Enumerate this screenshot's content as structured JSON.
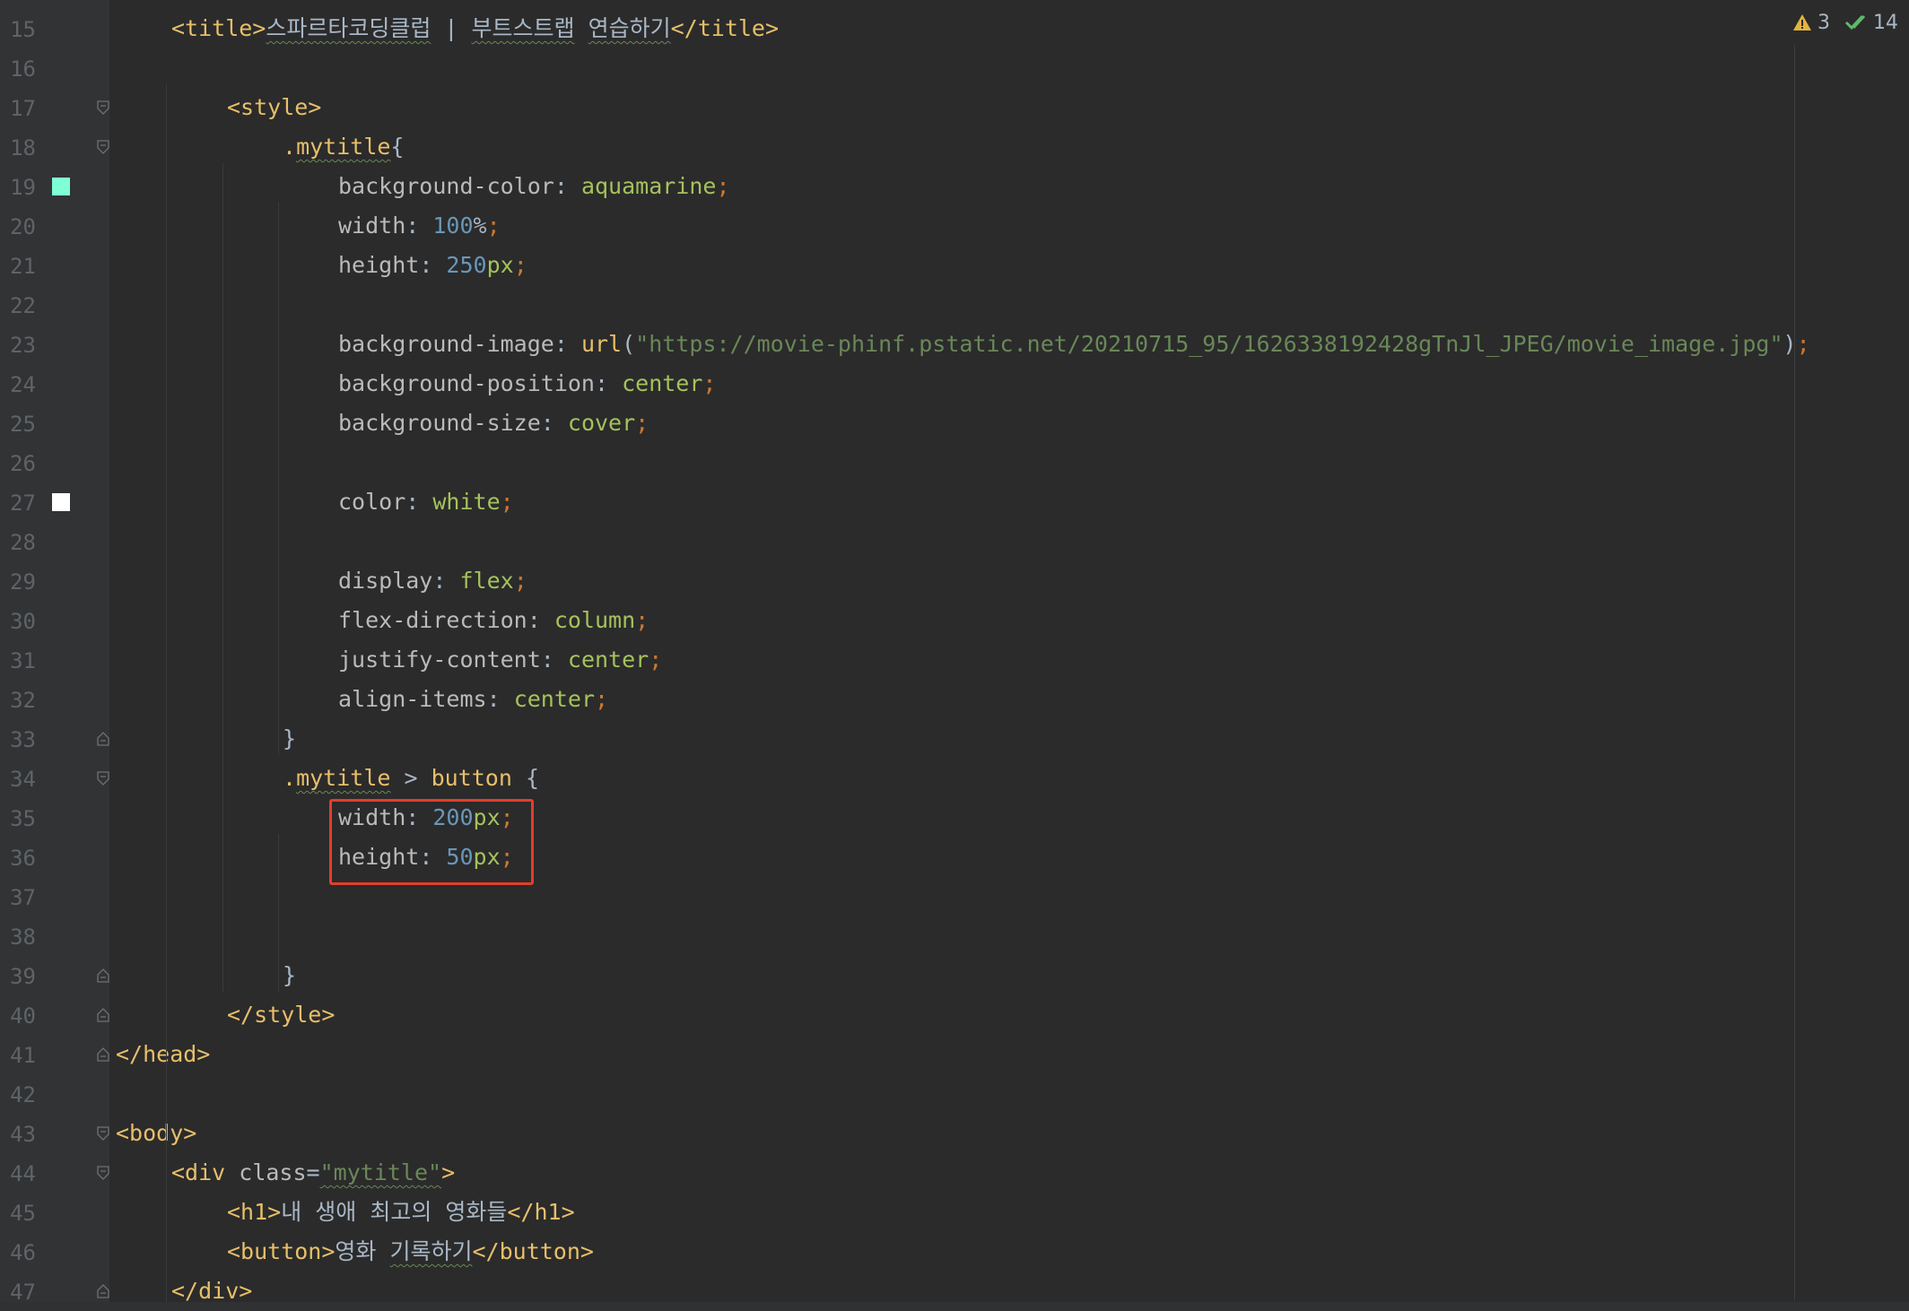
{
  "inspections": {
    "warnings_count": "3",
    "ok_count": "14",
    "warning_color": "#e3b341",
    "ok_color": "#5fb86a"
  },
  "colors": {
    "aquamarine_swatch": "#7fffd4",
    "white_swatch": "#ffffff",
    "highlight_box": "#e53d2c"
  },
  "lines": [
    {
      "n": "15",
      "segments": [
        [
          "tag",
          "<title>"
        ],
        [
          "plain",
          "스파르타코딩클럽"
        ],
        [
          "plain",
          " | "
        ],
        [
          "plain",
          "부트스트랩"
        ],
        [
          "plain",
          " "
        ],
        [
          "plain",
          "연습하기"
        ],
        [
          "tag",
          "</title>"
        ]
      ]
    },
    {
      "n": "16",
      "segments": []
    },
    {
      "n": "17",
      "segments": [
        [
          "tag",
          "<style>"
        ]
      ]
    },
    {
      "n": "18",
      "segments": [
        [
          "sel",
          "."
        ],
        [
          "sel",
          "mytitle"
        ],
        [
          "plain",
          "{"
        ]
      ]
    },
    {
      "n": "19",
      "segments": [
        [
          "prop",
          "background-color"
        ],
        [
          "plain",
          ": "
        ],
        [
          "val",
          "aquamarine"
        ],
        [
          "punc",
          ";"
        ]
      ]
    },
    {
      "n": "20",
      "segments": [
        [
          "prop",
          "width"
        ],
        [
          "plain",
          ": "
        ],
        [
          "num",
          "100"
        ],
        [
          "plain",
          "%"
        ],
        [
          "punc",
          ";"
        ]
      ]
    },
    {
      "n": "21",
      "segments": [
        [
          "prop",
          "height"
        ],
        [
          "plain",
          ": "
        ],
        [
          "num",
          "250"
        ],
        [
          "val",
          "px"
        ],
        [
          "punc",
          ";"
        ]
      ]
    },
    {
      "n": "22",
      "segments": []
    },
    {
      "n": "23",
      "segments": [
        [
          "prop",
          "background-image"
        ],
        [
          "plain",
          ": "
        ],
        [
          "tag",
          "url"
        ],
        [
          "plain",
          "("
        ],
        [
          "str",
          "\"https://movie-phinf.pstatic.net/20210715_95/1626338192428gTnJl_JPEG/movie_image.jpg\""
        ],
        [
          "plain",
          ")"
        ],
        [
          "punc",
          ";"
        ]
      ]
    },
    {
      "n": "24",
      "segments": [
        [
          "prop",
          "background-position"
        ],
        [
          "plain",
          ": "
        ],
        [
          "val",
          "center"
        ],
        [
          "punc",
          ";"
        ]
      ]
    },
    {
      "n": "25",
      "segments": [
        [
          "prop",
          "background-size"
        ],
        [
          "plain",
          ": "
        ],
        [
          "val",
          "cover"
        ],
        [
          "punc",
          ";"
        ]
      ]
    },
    {
      "n": "26",
      "segments": []
    },
    {
      "n": "27",
      "segments": [
        [
          "prop",
          "color"
        ],
        [
          "plain",
          ": "
        ],
        [
          "val",
          "white"
        ],
        [
          "punc",
          ";"
        ]
      ]
    },
    {
      "n": "28",
      "segments": []
    },
    {
      "n": "29",
      "segments": [
        [
          "prop",
          "display"
        ],
        [
          "plain",
          ": "
        ],
        [
          "val",
          "flex"
        ],
        [
          "punc",
          ";"
        ]
      ]
    },
    {
      "n": "30",
      "segments": [
        [
          "prop",
          "flex-direction"
        ],
        [
          "plain",
          ": "
        ],
        [
          "val",
          "column"
        ],
        [
          "punc",
          ";"
        ]
      ]
    },
    {
      "n": "31",
      "segments": [
        [
          "prop",
          "justify-content"
        ],
        [
          "plain",
          ": "
        ],
        [
          "val",
          "center"
        ],
        [
          "punc",
          ";"
        ]
      ]
    },
    {
      "n": "32",
      "segments": [
        [
          "prop",
          "align-items"
        ],
        [
          "plain",
          ": "
        ],
        [
          "val",
          "center"
        ],
        [
          "punc",
          ";"
        ]
      ]
    },
    {
      "n": "33",
      "segments": [
        [
          "plain",
          "}"
        ]
      ]
    },
    {
      "n": "34",
      "segments": [
        [
          "sel",
          "."
        ],
        [
          "sel",
          "mytitle"
        ],
        [
          "plain",
          " > "
        ],
        [
          "sel",
          "button"
        ],
        [
          "plain",
          " {"
        ]
      ]
    },
    {
      "n": "35",
      "segments": [
        [
          "prop",
          "width"
        ],
        [
          "plain",
          ": "
        ],
        [
          "num",
          "200"
        ],
        [
          "val",
          "px"
        ],
        [
          "punc",
          ";"
        ]
      ]
    },
    {
      "n": "36",
      "segments": [
        [
          "prop",
          "height"
        ],
        [
          "plain",
          ": "
        ],
        [
          "num",
          "50"
        ],
        [
          "val",
          "px"
        ],
        [
          "punc",
          ";"
        ]
      ]
    },
    {
      "n": "37",
      "segments": []
    },
    {
      "n": "38",
      "segments": []
    },
    {
      "n": "39",
      "segments": [
        [
          "plain",
          "}"
        ]
      ]
    },
    {
      "n": "40",
      "segments": [
        [
          "tag",
          "</style>"
        ]
      ]
    },
    {
      "n": "41",
      "segments": [
        [
          "tag",
          "</head>"
        ]
      ]
    },
    {
      "n": "42",
      "segments": []
    },
    {
      "n": "43",
      "segments": [
        [
          "tag",
          "<body>"
        ]
      ]
    },
    {
      "n": "44",
      "segments": [
        [
          "tag",
          "<div "
        ],
        [
          "attr",
          "class"
        ],
        [
          "plain",
          "="
        ],
        [
          "str",
          "\"mytitle\""
        ],
        [
          "tag",
          ">"
        ]
      ]
    },
    {
      "n": "45",
      "segments": [
        [
          "tag",
          "<h1>"
        ],
        [
          "plain",
          "내 생애 최고의 영화들"
        ],
        [
          "tag",
          "</h1>"
        ]
      ]
    },
    {
      "n": "46",
      "segments": [
        [
          "tag",
          "<button>"
        ],
        [
          "plain",
          "영화 "
        ],
        [
          "plain",
          "기록하기"
        ],
        [
          "tag",
          "</button>"
        ]
      ]
    },
    {
      "n": "47",
      "segments": [
        [
          "tag",
          "</div>"
        ]
      ]
    }
  ]
}
